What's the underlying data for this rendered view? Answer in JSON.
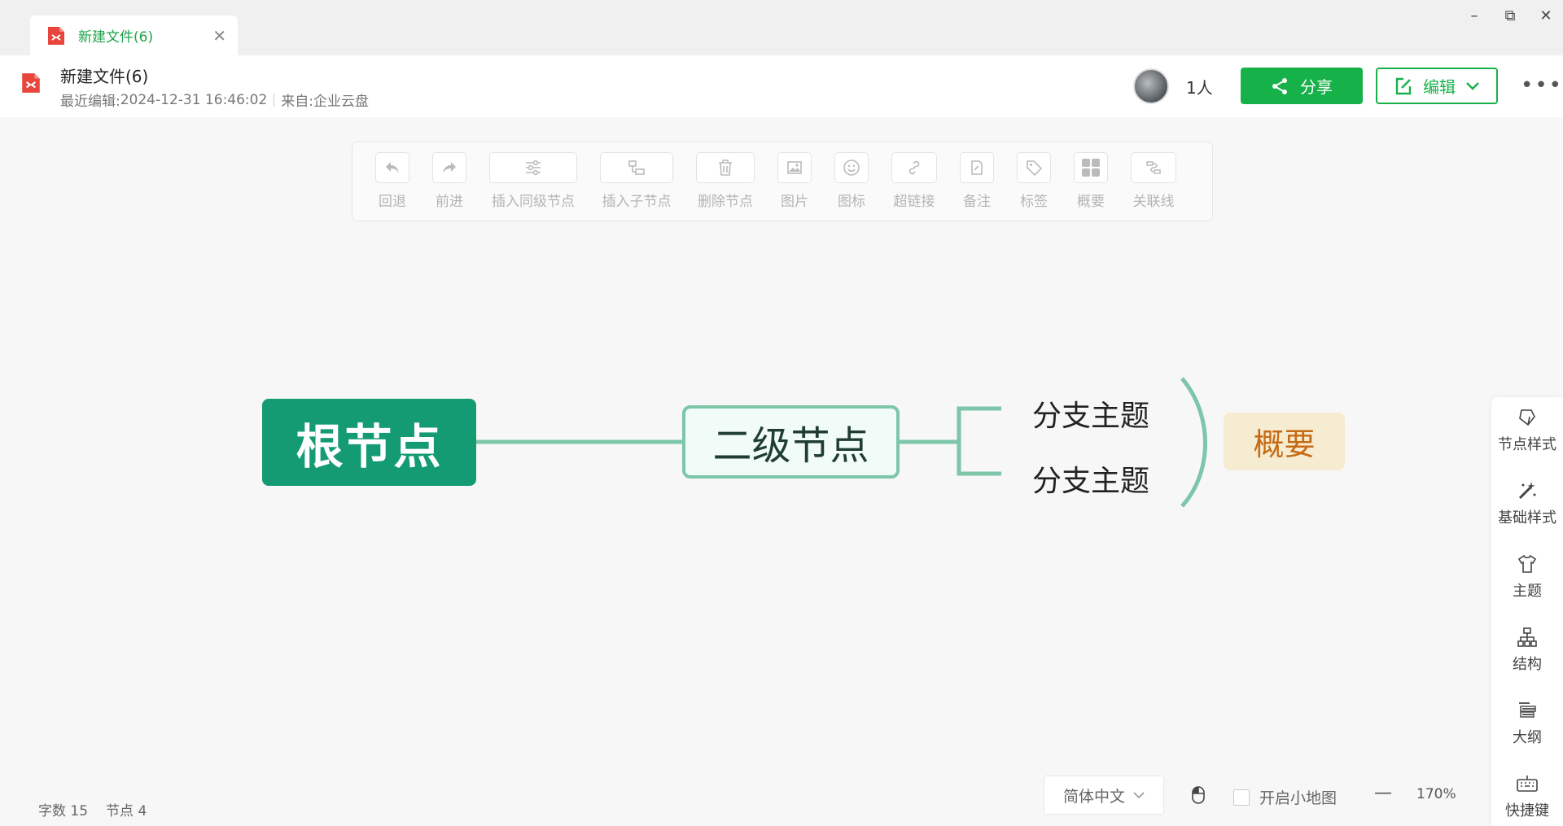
{
  "tab": {
    "title": "新建文件(6)",
    "close": "✕"
  },
  "window": {
    "minimize": "–",
    "restore": "⧉",
    "close": "✕"
  },
  "header": {
    "title": "新建文件(6)",
    "last_edit_label": "最近编辑:",
    "last_edit_time": "2024-12-31 16:46:02",
    "source_label": "来自:",
    "source": "企业云盘",
    "user_count": "1人",
    "share_label": "分享",
    "edit_label": "编辑",
    "more": "•••"
  },
  "toolbar": {
    "items": [
      {
        "label": "回退",
        "icon": "undo-icon"
      },
      {
        "label": "前进",
        "icon": "redo-icon"
      },
      {
        "label": "插入同级节点",
        "icon": "sibling-node-icon"
      },
      {
        "label": "插入子节点",
        "icon": "child-node-icon"
      },
      {
        "label": "删除节点",
        "icon": "trash-icon"
      },
      {
        "label": "图片",
        "icon": "image-icon"
      },
      {
        "label": "图标",
        "icon": "emoji-icon"
      },
      {
        "label": "超链接",
        "icon": "link-icon"
      },
      {
        "label": "备注",
        "icon": "note-icon"
      },
      {
        "label": "标签",
        "icon": "tag-icon"
      },
      {
        "label": "概要",
        "icon": "summary-icon"
      },
      {
        "label": "关联线",
        "icon": "relation-line-icon"
      }
    ]
  },
  "mindmap": {
    "root": "根节点",
    "level2": "二级节点",
    "branches": [
      "分支主题",
      "分支主题"
    ],
    "summary": "概要",
    "colors": {
      "root": "#149b73",
      "line": "#7dc6a9",
      "summary_bg": "#f6ecd1",
      "summary_text": "#c76a14"
    }
  },
  "right_panel": {
    "items": [
      {
        "label": "节点样式",
        "icon": "node-style-icon"
      },
      {
        "label": "基础样式",
        "icon": "magic-wand-icon"
      },
      {
        "label": "主题",
        "icon": "shirt-icon"
      },
      {
        "label": "结构",
        "icon": "structure-icon"
      },
      {
        "label": "大纲",
        "icon": "outline-icon"
      },
      {
        "label": "快捷键",
        "icon": "keyboard-icon"
      }
    ]
  },
  "status": {
    "word_count_label": "字数",
    "word_count": "15",
    "node_count_label": "节点",
    "node_count": "4",
    "language": "简体中文",
    "minimap_label": "开启小地图",
    "zoom_minus": "—",
    "zoom": "170%"
  },
  "accent_color": "#17b14a"
}
